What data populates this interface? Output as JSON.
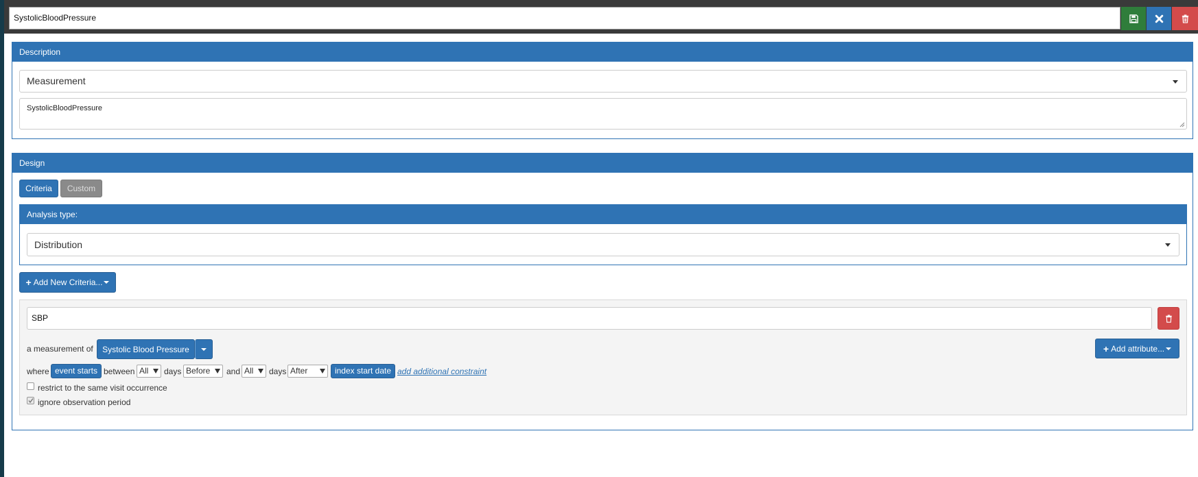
{
  "header": {
    "title_value": "SystolicBloodPressure",
    "icons": [
      "save-icon",
      "close-icon",
      "trash-icon"
    ]
  },
  "description": {
    "heading": "Description",
    "domain_select": "Measurement",
    "text": "SystolicBloodPressure"
  },
  "design": {
    "heading": "Design",
    "tabs": [
      "Criteria",
      "Custom"
    ],
    "analysis": {
      "heading": "Analysis type:",
      "select": "Distribution"
    },
    "add_criteria_label": "Add New Criteria...",
    "criteria": {
      "name_value": "SBP",
      "measurement_prefix": "a measurement of",
      "concept_label": "Systolic Blood Pressure",
      "add_attribute_label": "Add attribute...",
      "where_label": "where",
      "event_starts_label": "event starts",
      "between_label": "between",
      "all_1": "All",
      "days_1": "days",
      "before_select": "Before",
      "and_label": "and",
      "all_2": "All",
      "days_2": "days",
      "after_select": "After",
      "index_label": "index start date",
      "add_constraint_link": "add additional constraint",
      "restrict_label": "restrict to the same visit occurrence",
      "restrict_checked": false,
      "ignore_label": "ignore observation period",
      "ignore_checked": true
    }
  },
  "colors": {
    "primary": "#2f73b4",
    "success": "#2f7d3b",
    "danger": "#d34b4b",
    "inactive_tab": "#8a8a8a"
  }
}
